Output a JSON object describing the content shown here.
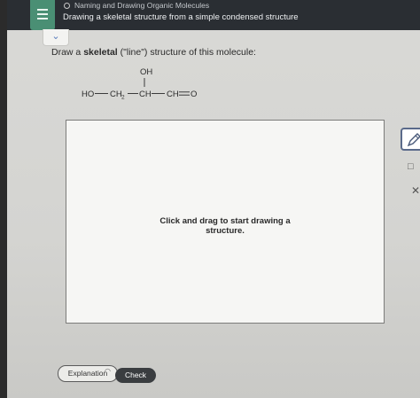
{
  "header": {
    "module_title": "Naming and Drawing Organic Molecules",
    "page_title": "Drawing a skeletal structure from a simple condensed structure"
  },
  "collapse_toggle": "⌄",
  "prompt": {
    "prefix": "Draw a ",
    "bold": "skeletal",
    "suffix": " (\"line\") structure of this molecule:"
  },
  "molecule": {
    "substituent": "OH",
    "group1": "HO",
    "group2": "CH",
    "group2_sub": "2",
    "group3": "CH",
    "group4": "CH",
    "group5": "O"
  },
  "canvas": {
    "hint_line1": "Click and drag to start drawing a",
    "hint_line2": "structure."
  },
  "tools": {
    "template_icon": "□",
    "clear_icon": "✕"
  },
  "buttons": {
    "explanation": "Explanation",
    "check": "Check"
  }
}
